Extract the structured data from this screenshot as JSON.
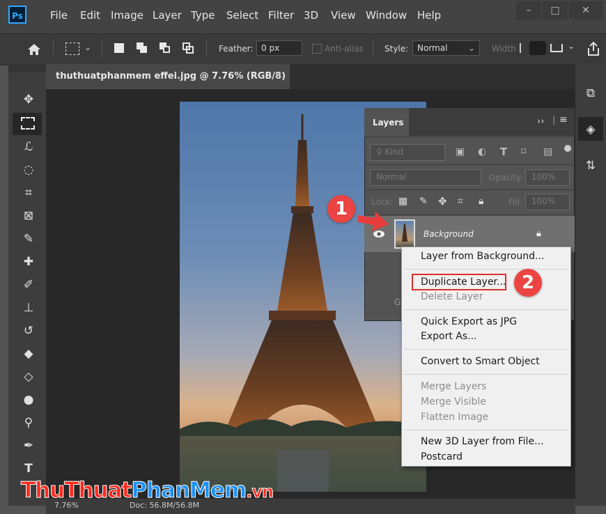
{
  "app": {
    "logo": "Ps",
    "menu": [
      "File",
      "Edit",
      "Image",
      "Layer",
      "Type",
      "Select",
      "Filter",
      "3D",
      "View",
      "Window",
      "Help"
    ],
    "window_buttons": [
      "–",
      "□",
      "✕"
    ]
  },
  "options_bar": {
    "feather_label": "Feather:",
    "feather_value": "0 px",
    "antialias_label": "Anti-alias",
    "style_label": "Style:",
    "style_value": "Normal",
    "width_label": "Width"
  },
  "document": {
    "tab_title": "thuthuatphanmem effei.jpg @ 7.76% (RGB/8)",
    "close": "×",
    "zoom": "7.76%",
    "doc_info": "Doc: 56.8M/56.8M"
  },
  "layers_panel": {
    "title": "Layers",
    "filter_kind": "Kind",
    "blend_mode": "Normal",
    "opacity_label": "Opacity:",
    "opacity_value": "100%",
    "lock_label": "Lock:",
    "fill_label": "Fill:",
    "fill_value": "100%",
    "layer_name": "Background",
    "partial_label": "G"
  },
  "context_menu": {
    "items": [
      {
        "label": "Layer from Background...",
        "enabled": true
      },
      {
        "label": "Duplicate Layer...",
        "enabled": true,
        "highlighted": true
      },
      {
        "label": "Delete Layer",
        "enabled": false
      },
      {
        "label": "Quick Export as JPG",
        "enabled": true
      },
      {
        "label": "Export As...",
        "enabled": true
      },
      {
        "label": "Convert to Smart Object",
        "enabled": true
      },
      {
        "label": "Merge Layers",
        "enabled": false
      },
      {
        "label": "Merge Visible",
        "enabled": false
      },
      {
        "label": "Flatten Image",
        "enabled": false
      },
      {
        "label": "New 3D Layer from File...",
        "enabled": true
      },
      {
        "label": "Postcard",
        "enabled": true
      }
    ]
  },
  "annotations": {
    "step1": "1",
    "step2": "2",
    "highlight_color": "#d9302c"
  },
  "watermark": {
    "part1": "Thu",
    "part2": "Thuat",
    "part3": "PhanMem",
    "part4": ".vn"
  },
  "colors": {
    "menubar": "#434343",
    "panel": "#535353",
    "badge": "#ec4343"
  }
}
